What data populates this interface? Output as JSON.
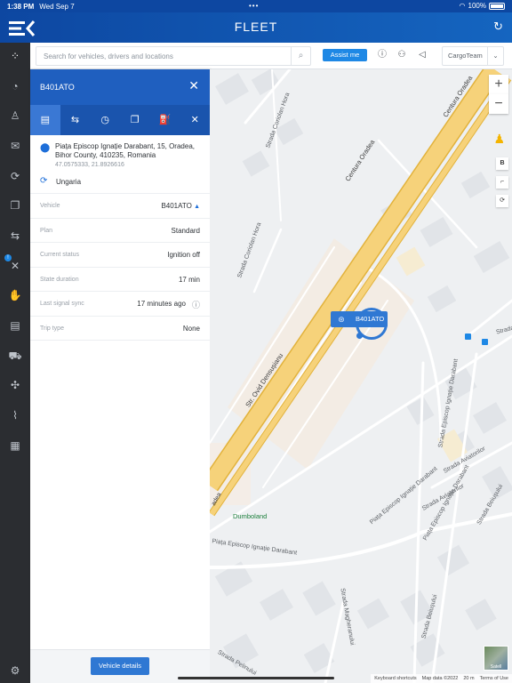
{
  "status": {
    "time": "1:38 PM",
    "date": "Wed Sep 7",
    "battery": "100%"
  },
  "header": {
    "title": "FLEET"
  },
  "search": {
    "placeholder": "Search for vehicles, drivers and locations"
  },
  "topbar": {
    "assist_label": "Assist me",
    "team_label": "CargoTeam"
  },
  "panel": {
    "plate": "B401ATO",
    "address_line1": "Piața Episcop Ignație Darabant, 15, Oradea,",
    "address_line2": "Bihor County, 410235, Romania",
    "coords": "47.0575333, 21.8926616",
    "country": "Ungaria",
    "rows": [
      {
        "label": "Vehicle",
        "value": "B401ATO"
      },
      {
        "label": "Plan",
        "value": "Standard"
      },
      {
        "label": "Current status",
        "value": "Ignition off"
      },
      {
        "label": "State duration",
        "value": "17 min"
      },
      {
        "label": "Last signal sync",
        "value": "17 minutes ago"
      },
      {
        "label": "Trip type",
        "value": "None"
      }
    ],
    "details_button": "Vehicle details"
  },
  "map": {
    "marker_label": "B401ATO",
    "labels": {
      "centura1": "Centura Oradea",
      "centura2": "Centura Oradea",
      "dumbo": "Dumboland",
      "ovid": "Str. Ovid Densușianu",
      "coriolan1": "Strada Coriolan Hora",
      "coriolan2": "Strada Coriolan Hora",
      "darabant1": "Strada Episcop Ignație Darabant",
      "darabant2": "Piața Episcop Ignație Darabant",
      "darabant3": "Piața Episcop Ignație Darabant",
      "darabant4": "Piața Episcop Ignație Darabant",
      "aviatorilor1": "Strada Aviatorilor",
      "aviatorilor2": "Strada Aviatorilor",
      "beiusului1": "Strada Beiușului",
      "beiusului2": "Strada Beiușului",
      "magheranului": "Strada Magheranului",
      "pelinului": "Strada Pelinului",
      "strada_edge": "Strada",
      "adea": "adea"
    },
    "attribution": [
      "Keyboard shortcuts",
      "Map data ©2022",
      "20 m",
      "Terms of Use"
    ],
    "sat_label": "Satell"
  },
  "colors": {
    "brand": "#1565c0",
    "panel_header": "#1f5fbf",
    "accent": "#2f78d3",
    "road_major": "#f6d27a"
  },
  "icons": {
    "tabs": [
      "document-icon",
      "route-icon",
      "history-icon",
      "copy-icon",
      "fuel-icon",
      "tools-icon"
    ],
    "sidebar": [
      "fleet-logo-icon",
      "dashboard-icon",
      "user-icon",
      "chat-icon",
      "sync-icon",
      "documents-icon",
      "routes-icon",
      "tools-icon",
      "hand-icon",
      "reports-icon",
      "car-icon",
      "network-icon",
      "activity-icon",
      "grid-icon",
      "settings-icon"
    ]
  }
}
